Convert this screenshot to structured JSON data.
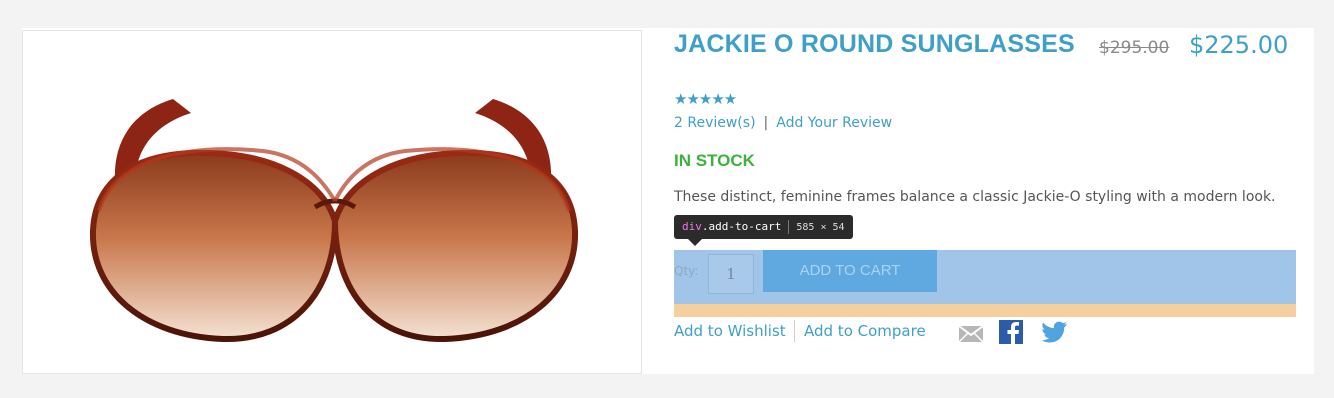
{
  "product": {
    "title": "JACKIE O ROUND SUNGLASSES",
    "old_price": "$295.00",
    "price": "$225.00",
    "rating_stars": "★★★★★",
    "reviews_link": "2 Review(s)",
    "review_separator": "|",
    "add_review_link": "Add Your Review",
    "stock_status": "IN STOCK",
    "description": "These distinct, feminine frames balance a classic Jackie-O styling with a modern look."
  },
  "devtools_tooltip": {
    "tag": "div",
    "class": ".add-to-cart",
    "size": "585 × 54"
  },
  "cart": {
    "qty_label": "Qty:",
    "qty_value": "1",
    "button_label": "ADD TO CART"
  },
  "actions": {
    "wishlist": "Add to Wishlist",
    "compare": "Add to Compare"
  },
  "icons": {
    "share_email": "mail-icon",
    "share_facebook": "facebook-icon",
    "share_twitter": "twitter-icon"
  },
  "colors": {
    "accent": "#3e9fc9",
    "in_stock": "#3bb33b",
    "highlight_content": "#a0c5e8",
    "highlight_margin": "#f6cf9f"
  }
}
